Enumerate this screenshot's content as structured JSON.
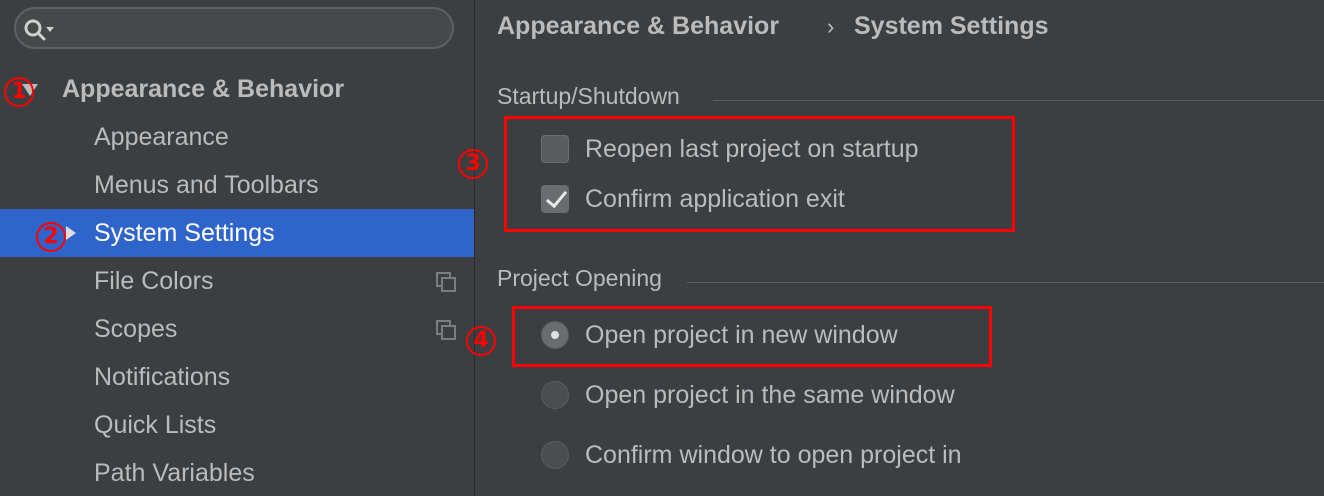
{
  "search": {
    "placeholder": ""
  },
  "sidebar": {
    "items": [
      {
        "label": "Appearance & Behavior"
      },
      {
        "label": "Appearance"
      },
      {
        "label": "Menus and Toolbars"
      },
      {
        "label": "System Settings"
      },
      {
        "label": "File Colors"
      },
      {
        "label": "Scopes"
      },
      {
        "label": "Notifications"
      },
      {
        "label": "Quick Lists"
      },
      {
        "label": "Path Variables"
      }
    ]
  },
  "breadcrumb": {
    "parent": "Appearance & Behavior",
    "separator": "›",
    "current": "System Settings"
  },
  "startup": {
    "title": "Startup/Shutdown",
    "reopen_label": "Reopen last project on startup",
    "reopen_checked": false,
    "confirm_exit_label": "Confirm application exit",
    "confirm_exit_checked": true
  },
  "project_opening": {
    "title": "Project Opening",
    "options": [
      {
        "label": "Open project in new window",
        "selected": true
      },
      {
        "label": "Open project in the same window",
        "selected": false
      },
      {
        "label": "Confirm window to open project in",
        "selected": false
      }
    ]
  },
  "annotations": [
    "1",
    "2",
    "3",
    "4"
  ],
  "colors": {
    "background": "#3c3f41",
    "selection": "#2f65ca",
    "annotation": "#ff0000",
    "text": "#bbbbbb"
  }
}
